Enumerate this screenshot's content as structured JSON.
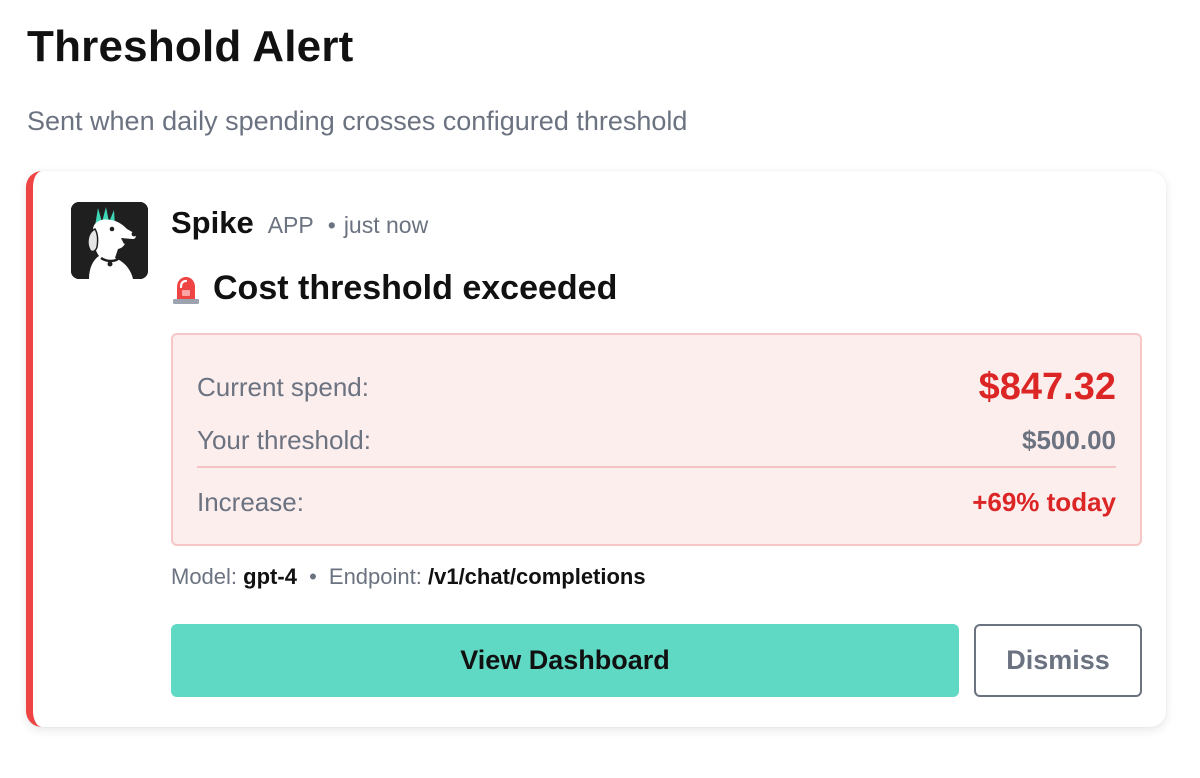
{
  "page": {
    "title": "Threshold Alert",
    "subtitle": "Sent when daily spending crosses configured threshold"
  },
  "message": {
    "avatar_icon": "dog-logo-icon",
    "sender": "Spike",
    "badge": "APP",
    "separator": "•",
    "timestamp": "just now",
    "alert_icon": "siren-icon",
    "alert_title": "Cost threshold exceeded"
  },
  "stats": {
    "current_spend_label": "Current spend:",
    "current_spend_value": "$847.32",
    "threshold_label": "Your threshold:",
    "threshold_value": "$500.00",
    "increase_label": "Increase:",
    "increase_value": "+69% today"
  },
  "meta": {
    "model_label": "Model:",
    "model_value": "gpt-4",
    "separator": "•",
    "endpoint_label": "Endpoint:",
    "endpoint_value": "/v1/chat/completions"
  },
  "actions": {
    "primary_label": "View Dashboard",
    "secondary_label": "Dismiss"
  },
  "colors": {
    "accent_border": "#ef4444",
    "alert_red": "#dc2626",
    "stats_background": "#fdeeee",
    "stats_border": "#f7c6c6",
    "primary_button": "#5fd9c4",
    "muted_text": "#6b7280"
  }
}
